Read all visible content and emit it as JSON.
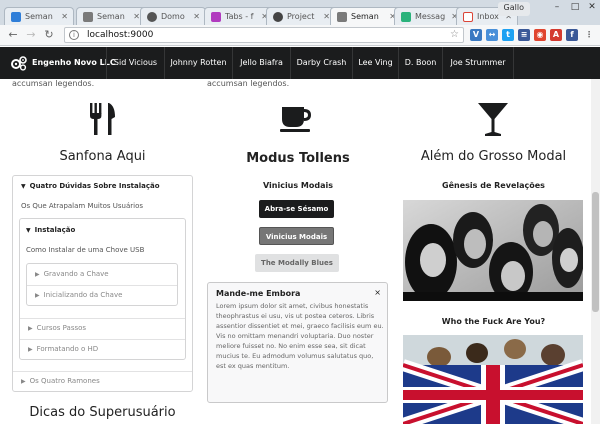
{
  "browser": {
    "tabs": [
      {
        "title": "Seman",
        "color": "#2f7ed8"
      },
      {
        "title": "Seman",
        "color": "#7a7a7a"
      },
      {
        "title": "Domo",
        "color": "#555555"
      },
      {
        "title": "Tabs - f",
        "color": "#b13bbf"
      },
      {
        "title": "Project",
        "color": "#444444"
      },
      {
        "title": "Seman",
        "color": "#7a7a7a"
      },
      {
        "title": "Messag",
        "color": "#2ab27b"
      },
      {
        "title": "Inbox",
        "color": "#db4437"
      }
    ],
    "user": "Gallo",
    "url": "localhost:9000",
    "extensions": [
      {
        "label": "V",
        "color": "#3a79c2"
      },
      {
        "label": "↔",
        "color": "#4a90d9"
      },
      {
        "label": "t",
        "color": "#1da1f2"
      },
      {
        "label": "≡",
        "color": "#3b5998"
      },
      {
        "label": "◉",
        "color": "#e0452f"
      },
      {
        "label": "A",
        "color": "#d43a2f"
      },
      {
        "label": "f",
        "color": "#3b5998"
      },
      {
        "label": "⋮",
        "color": "#666666"
      }
    ]
  },
  "nav": {
    "brand": "Engenho Novo LLC",
    "items": [
      "Sid Vicious",
      "Johnny Rotten",
      "Jello Biafra",
      "Darby Crash",
      "Lee Ving",
      "D. Boon",
      "Joe Strummer"
    ]
  },
  "col1": {
    "cutoff": "accumsan legendos.",
    "title": "Sanfona Aqui",
    "accordion": {
      "title1": "Quatro Dúvidas Sobre Instalação",
      "text1": "Os Que Atrapalam Muitos Usuários",
      "title2": "Instalação",
      "text2": "Como Instalar de uma Chove USB",
      "items3": [
        "Gravando a Chave",
        "Inicializando da Chave"
      ],
      "items2": [
        "Cursos Passos",
        "Formatando o HD"
      ],
      "items1": [
        "Os Quatro Ramones"
      ]
    },
    "bottom_title": "Dicas do Superusuário"
  },
  "col2": {
    "cutoff": "accumsan legendos.",
    "title": "Modus Tollens",
    "subtitle": "Vinicius Modais",
    "buttons": [
      "Abra-se Sésamo",
      "Vinicius Modais",
      "The Modally Blues"
    ],
    "message": {
      "header": "Mande-me Embora",
      "close": "×",
      "body": "Lorem ipsum dolor sit amet, civibus honestatis theophrastus ei usu, vis ut postea ceteros. Libris assentior dissentiet et mei, graeco facilisis eum eu. Vis no omittam menandri voluptaria. Duo noster meliore fuisset no. No enim esse sea, sit dicat mucius te. Eu admodum volumus salutatus quo, est ex quas mentitum."
    },
    "colors": {
      "accent": "#1b1c1d",
      "grey": "#767676",
      "light": "#e0e1e2"
    }
  },
  "col3": {
    "title": "Além do Grosso Modal",
    "subtitle1": "Gênesis de Revelações",
    "subtitle2": "Who the Fuck Are You?"
  }
}
